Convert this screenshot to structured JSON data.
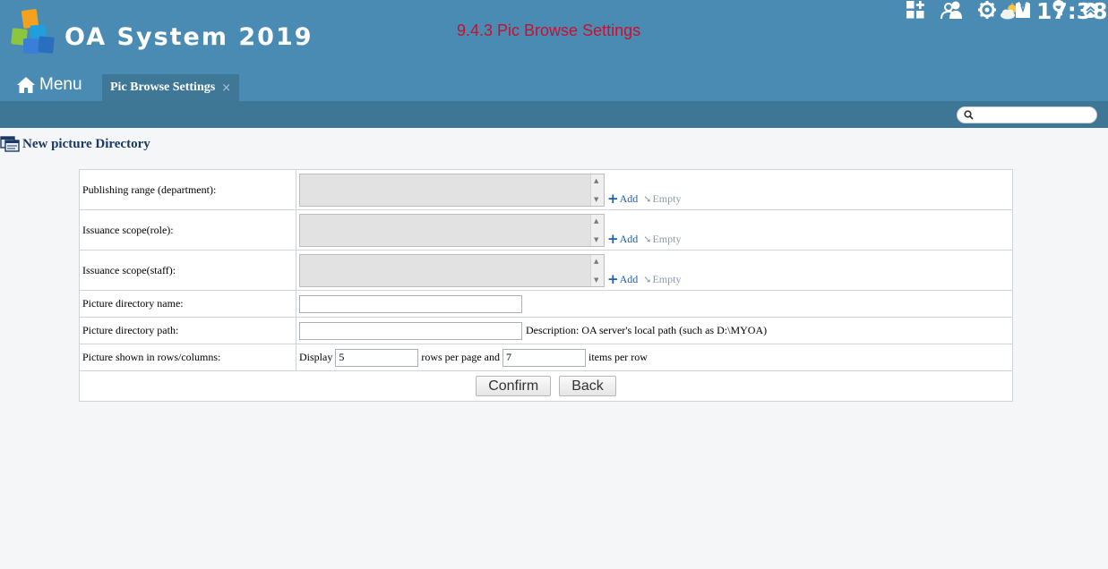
{
  "header": {
    "app_title": "OA System 2019",
    "page_caption": "9.4.3 Pic Browse Settings",
    "time": "17:38",
    "weather_icon": "partly-cloudy-icon",
    "menu_label": "Menu",
    "tab_label": "Pic Browse Settings",
    "tab_close": "×",
    "toolbar_icons": [
      "add-app-icon",
      "users-icon",
      "gear-icon",
      "shirt-icon",
      "key-icon",
      "chevron-up-circle-icon"
    ]
  },
  "search": {
    "placeholder": ""
  },
  "section": {
    "title": "New picture Directory"
  },
  "form": {
    "rows": {
      "dept": {
        "label": "Publishing range (department):"
      },
      "role": {
        "label": "Issuance scope(role):"
      },
      "staff": {
        "label": "Issuance scope(staff):"
      },
      "name": {
        "label": "Picture directory name:",
        "value": ""
      },
      "path": {
        "label": "Picture directory path:",
        "value": "",
        "description": "Description: OA server's local path (such as D:\\MYOA)"
      },
      "grid": {
        "label": "Picture shown in rows/columns:",
        "display": "Display",
        "rows_value": "5",
        "rows_text": "rows per page and",
        "cols_value": "7",
        "cols_text": "items per row"
      }
    },
    "add_label": "Add",
    "empty_label": "Empty",
    "confirm_label": "Confirm",
    "back_label": "Back"
  },
  "colors": {
    "header_bg": "#4a8bb4",
    "subbar_bg": "#3e7796",
    "caption_red": "#c8102e",
    "link_blue": "#1c5fb0"
  }
}
